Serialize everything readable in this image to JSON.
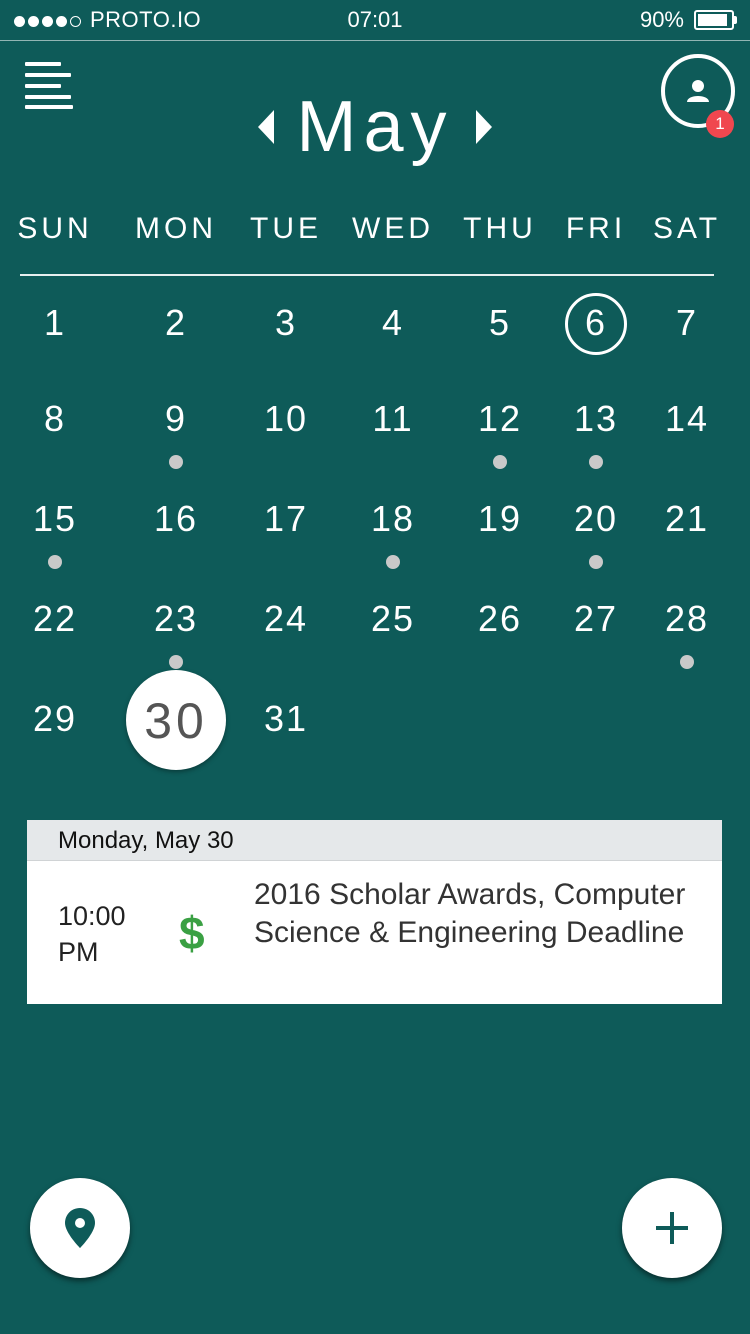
{
  "status_bar": {
    "carrier": "PROTO.IO",
    "time": "07:01",
    "battery_text": "90%",
    "battery_level": 0.9,
    "signal_dots_filled": 4,
    "signal_dots_total": 5
  },
  "header": {
    "month": "May",
    "notification_count": "1"
  },
  "weekdays": [
    "SUN",
    "MON",
    "TUE",
    "WED",
    "THU",
    "FRI",
    "SAT"
  ],
  "calendar": {
    "days": [
      "1",
      "2",
      "3",
      "4",
      "5",
      "6",
      "7",
      "8",
      "9",
      "10",
      "11",
      "12",
      "13",
      "14",
      "15",
      "16",
      "17",
      "18",
      "19",
      "20",
      "21",
      "22",
      "23",
      "24",
      "25",
      "26",
      "27",
      "28",
      "29",
      "30",
      "31"
    ],
    "first_weekday_index": 0,
    "today": "6",
    "selected": "30",
    "event_days": [
      "9",
      "12",
      "13",
      "15",
      "18",
      "20",
      "23",
      "28"
    ]
  },
  "event_panel": {
    "date_heading": "Monday, May 30",
    "events": [
      {
        "time_line1": "10:00",
        "time_line2": "PM",
        "icon_text": "$",
        "icon_name": "dollar-icon",
        "title": "2016 Scholar Awards, Computer Science & Engineering Deadline"
      }
    ]
  },
  "colors": {
    "background": "#0e5b59",
    "badge": "#f0474f",
    "event_dot": "#c9c9c9",
    "dollar": "#3aa043",
    "fab_icon": "#0e5b59"
  },
  "icons": {
    "menu": "hamburger-menu-icon",
    "profile": "user-profile-icon",
    "prev": "caret-left-icon",
    "next": "caret-right-icon",
    "location": "location-pin-icon",
    "add": "plus-icon"
  }
}
